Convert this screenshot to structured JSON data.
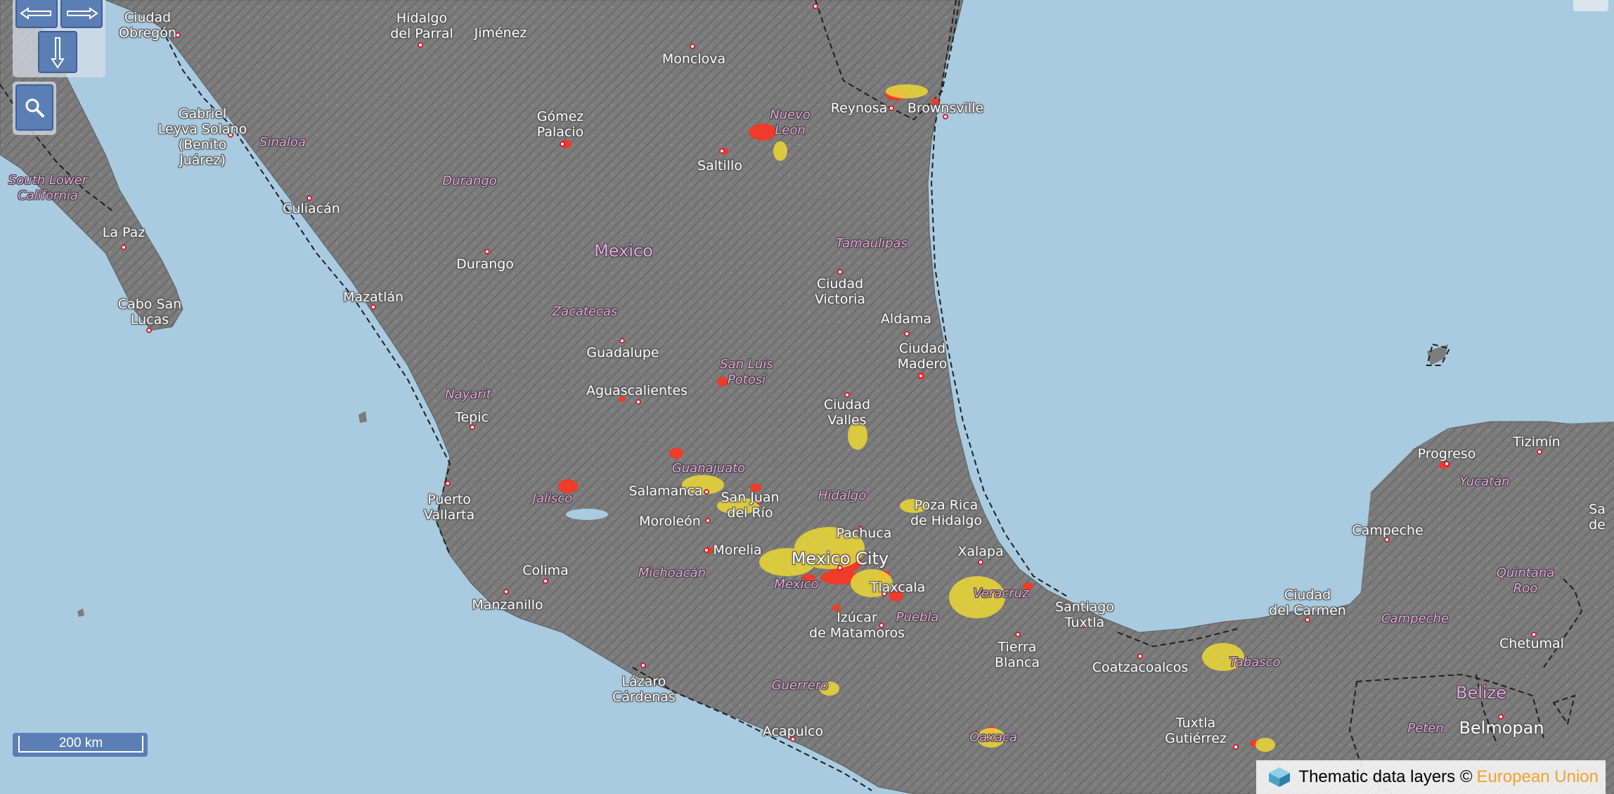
{
  "map": {
    "country_labels": {
      "mexico": "Mexico",
      "belize": "Belize"
    },
    "state_labels": {
      "south_lower_california": "South Lower\nCalifornia",
      "sinaloa": "Sinaloa",
      "durango": "Durango",
      "nuevo_leon": "Nuevo\nLeón",
      "tamaulipas": "Tamaulipas",
      "zacatecas": "Zacatecas",
      "san_luis_potosi": "San Luis\nPotosí",
      "nayarit": "Nayarit",
      "guanajuato": "Guanajuato",
      "jalisco": "Jalisco",
      "hidalgo": "Hidalgo",
      "michoacan": "Michoacán",
      "mexico_state": "Mexico",
      "veracruz": "Veracruz",
      "puebla": "Puebla",
      "guerrero": "Guerrero",
      "oaxaca": "Oaxaca",
      "tabasco": "Tabasco",
      "campeche_state": "Campeche",
      "yucatan": "Yucatán",
      "quintana_roo": "Quintana\nRoo",
      "peten": "Petén"
    },
    "city_labels": {
      "ciudad_obregon": "Ciudad\nObregón",
      "hidalgo_del_parral": "Hidalgo\ndel Parral",
      "jimenez": "Jiménez",
      "monclova": "Monclova",
      "gabriel_leyva": "Gabriel\nLeyva Solano\n(Benito\nJuárez)",
      "gomez_palacio": "Gómez\nPalacio",
      "saltillo": "Saltillo",
      "reynosa": "Reynosa",
      "brownsville": "Brownsville",
      "culiacan": "Culiacán",
      "la_paz": "La Paz",
      "durango_city": "Durango",
      "mazatlan": "Mazatlán",
      "cabo_san_lucas": "Cabo San\nLucas",
      "ciudad_victoria": "Ciudad\nVictoria",
      "aldama": "Aldama",
      "ciudad_madero": "Ciudad\nMadero",
      "guadalupe": "Guadalupe",
      "aguascalientes": "Aguascalientes",
      "ciudad_valles": "Ciudad\nValles",
      "tepic": "Tepic",
      "puerto_vallarta": "Puerto\nVallarta",
      "salamanca": "Salamanca",
      "san_juan_del_rio": "San Juan\ndel Río",
      "moroleon": "Moroleón",
      "poza_rica": "Poza Rica\nde Hidalgo",
      "pachuca": "Pachuca",
      "morelia": "Morelia",
      "mexico_city": "Mexico City",
      "xalapa": "Xalapa",
      "colima": "Colima",
      "tlaxcala": "Tlaxcala",
      "manzanillo": "Manzanillo",
      "izucar": "Izúcar\nde Matamoros",
      "santiago_tuxtla": "Santiago\nTuxtla",
      "tierra_blanca": "Tierra\nBlanca",
      "coatzacoalcos": "Coatzacoalcos",
      "lazaro_cardenas": "Lázaro\nCárdenas",
      "acapulco": "Acapulco",
      "tuxtla_gutierrez": "Tuxtla\nGutiérrez",
      "progreso": "Progreso",
      "tizimin": "Tizimín",
      "campeche_city": "Campeche",
      "ciudad_del_carmen": "Ciudad\ndel Carmen",
      "chetumal": "Chetumal",
      "belmopan": "Belmopan",
      "sa_edge": "Sa\nde"
    },
    "colors": {
      "water": "#a9cbe0",
      "land": "#7a7a7a",
      "built_up_high": "#ee3b2a",
      "built_up_low": "#e6d23a",
      "border": "#222222"
    }
  },
  "controls": {
    "pan_left_icon": "arrow-left-icon",
    "pan_right_icon": "arrow-right-icon",
    "pan_down_icon": "arrow-down-icon",
    "zoom_icon": "magnifier-icon"
  },
  "scale_bar": {
    "label": "200 km"
  },
  "attribution": {
    "text": "Thematic data layers ©",
    "link": "European Union"
  }
}
